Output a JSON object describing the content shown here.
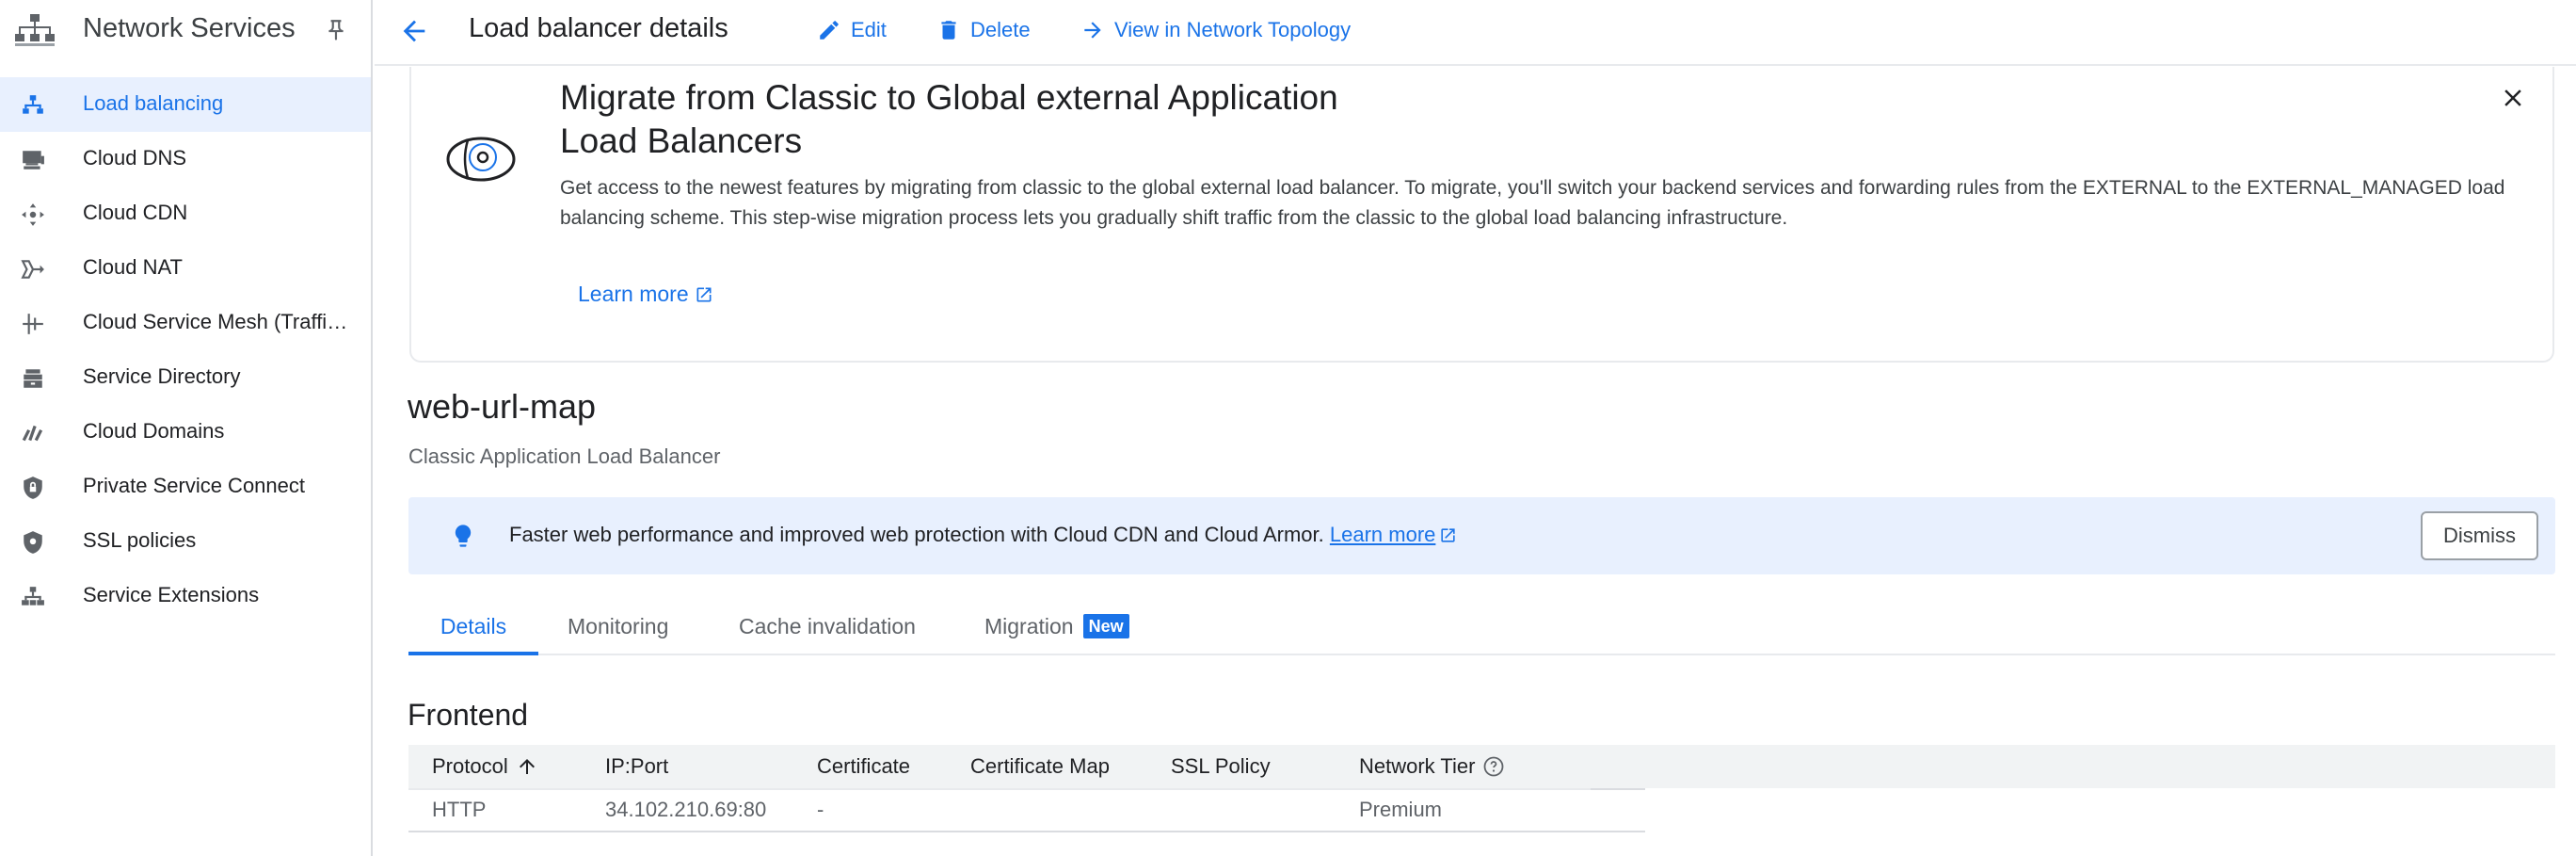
{
  "app": {
    "title": "Network Services"
  },
  "sidebar": {
    "items": [
      {
        "label": "Load balancing",
        "icon": "load-balancing-icon"
      },
      {
        "label": "Cloud DNS",
        "icon": "cloud-dns-icon"
      },
      {
        "label": "Cloud CDN",
        "icon": "cloud-cdn-icon"
      },
      {
        "label": "Cloud NAT",
        "icon": "cloud-nat-icon"
      },
      {
        "label": "Cloud Service Mesh (Traffic Director)",
        "icon": "service-mesh-icon"
      },
      {
        "label": "Service Directory",
        "icon": "service-directory-icon"
      },
      {
        "label": "Cloud Domains",
        "icon": "cloud-domains-icon"
      },
      {
        "label": "Private Service Connect",
        "icon": "private-service-connect-icon"
      },
      {
        "label": "SSL policies",
        "icon": "ssl-policies-icon"
      },
      {
        "label": "Service Extensions",
        "icon": "service-extensions-icon"
      }
    ],
    "active_index": 0
  },
  "topbar": {
    "title": "Load balancer details",
    "edit_label": "Edit",
    "delete_label": "Delete",
    "topology_label": "View in Network Topology"
  },
  "banner": {
    "title": "Migrate from Classic to Global external Application Load Balancers",
    "text": "Get access to the newest features by migrating from classic to the global external load balancer. To migrate, you'll switch your backend services and forwarding rules from the EXTERNAL to the EXTERNAL_MANAGED load balancing scheme. This step-wise migration process lets you gradually shift traffic from the classic to the global load balancing infrastructure.",
    "link_label": "Learn more"
  },
  "load_balancer": {
    "name": "web-url-map",
    "type": "Classic Application Load Balancer"
  },
  "tip": {
    "text": "Faster web performance and improved web protection with Cloud CDN and Cloud Armor.",
    "link_label": "Learn more",
    "dismiss_label": "Dismiss"
  },
  "tabs": [
    {
      "label": "Details"
    },
    {
      "label": "Monitoring"
    },
    {
      "label": "Cache invalidation"
    },
    {
      "label": "Migration",
      "badge": "New"
    }
  ],
  "active_tab": 0,
  "frontend": {
    "title": "Frontend",
    "columns": [
      "Protocol",
      "IP:Port",
      "Certificate",
      "Certificate Map",
      "SSL Policy",
      "Network Tier"
    ],
    "rows": [
      [
        "HTTP",
        "34.102.210.69:80",
        "-",
        "",
        "",
        "Premium"
      ]
    ]
  },
  "colors": {
    "accent": "#1a73e8",
    "active_bg": "#e8f0fe",
    "tip_bg": "#e8f0fe",
    "header_bg": "#f1f3f4"
  }
}
